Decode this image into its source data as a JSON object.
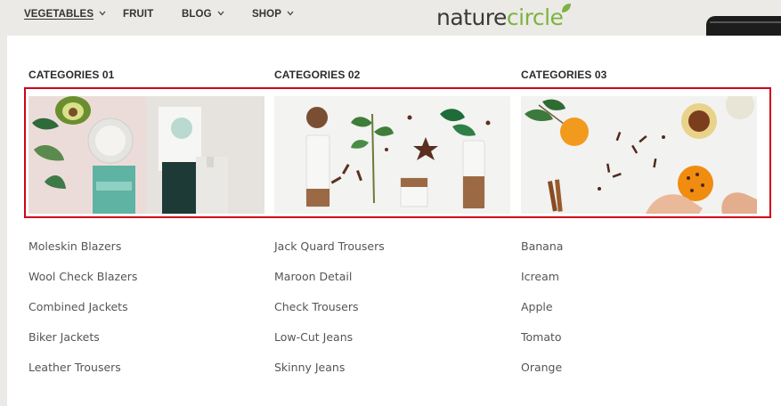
{
  "nav": {
    "items": [
      {
        "label": "VEGETABLES",
        "dropdown": true,
        "active": true
      },
      {
        "label": "FRUIT",
        "dropdown": false
      },
      {
        "label": "BLOG",
        "dropdown": true
      },
      {
        "label": "SHOP",
        "dropdown": true
      }
    ]
  },
  "logo": {
    "part1": "nature",
    "part2": "circle"
  },
  "menu": {
    "columns": [
      {
        "title": "CATEGORIES 01",
        "banner_icon": "cosmetics-product-banner",
        "links": [
          "Moleskin Blazers",
          "Wool Check Blazers",
          "Combined Jackets",
          "Biker Jackets",
          "Leather Trousers"
        ]
      },
      {
        "title": "CATEGORIES 02",
        "banner_icon": "spices-herbs-banner",
        "links": [
          "Jack Quard Trousers",
          "Maroon Detail",
          "Check Trousers",
          "Low-Cut Jeans",
          "Skinny Jeans"
        ]
      },
      {
        "title": "CATEGORIES 03",
        "banner_icon": "orange-cloves-banner",
        "links": [
          "Banana",
          "Icream",
          "Apple",
          "Tomato",
          "Orange"
        ]
      }
    ]
  },
  "colors": {
    "highlight": "#d0021b",
    "logo_dark": "#3a3a3a",
    "logo_green": "#7cb342"
  }
}
